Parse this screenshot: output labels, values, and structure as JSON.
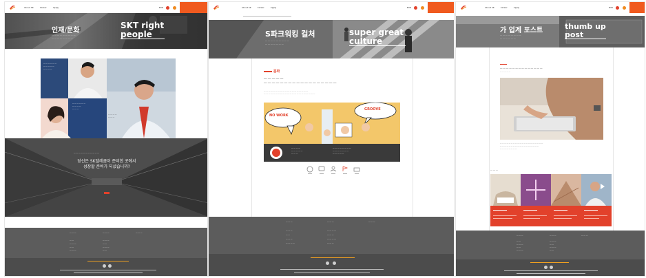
{
  "page1": {
    "nav": {
      "items": [
        "About SK",
        "Career",
        "Apply"
      ]
    },
    "hero": {
      "title_ko": "인재/문화",
      "title_en": "SKT right people"
    },
    "mid": {
      "quote_line1": "당신은 SK텔레콤이 준비한 곳에서",
      "quote_line2": "성장할 준비가 되셨습니까?"
    }
  },
  "page2": {
    "hero": {
      "title_ko": "S파크워킹 컬처",
      "title_en": "super great culture"
    },
    "section_title": "문화",
    "bubble_left": "NO WORK",
    "bubble_right": "GROOVE"
  },
  "page3": {
    "hero": {
      "title_ko": "가 업계 포스트",
      "title_en": "thumb up post"
    }
  },
  "colors": {
    "accent": "#f05a1f",
    "red": "#e2412b",
    "footer": "#5c5c5c",
    "footer_dark": "#4c4c4c"
  }
}
